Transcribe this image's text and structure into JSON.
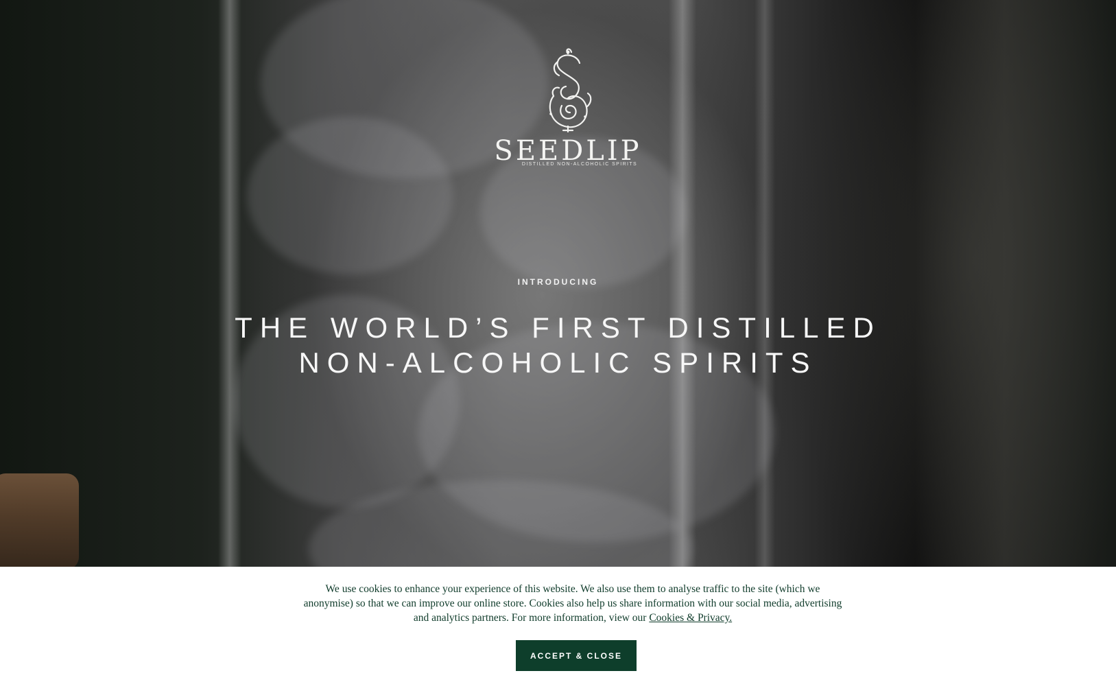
{
  "brand": {
    "name": "SEEDLIP",
    "tagline": "DISTILLED NON-ALCOHOLIC SPIRITS",
    "logo_icon": "seedlip-monogram-icon"
  },
  "hero": {
    "eyebrow": "INTRODUCING",
    "headline_line1": "THE WORLD’S FIRST DISTILLED",
    "headline_line2": "NON-ALCOHOLIC SPIRITS"
  },
  "cookie_banner": {
    "message": "We use cookies to enhance your experience of this website. We also use them to analyse traffic to the site (which we anonymise) so that we can improve our online store. Cookies also help us share information with our social media, advertising and analytics partners. For more information, view our ",
    "link_label": "Cookies & Privacy.",
    "accept_label": "ACCEPT & CLOSE"
  },
  "colors": {
    "brand_green": "#0e3e2b",
    "text_green": "#0f3b2a",
    "hero_text": "#f7f7f7"
  }
}
